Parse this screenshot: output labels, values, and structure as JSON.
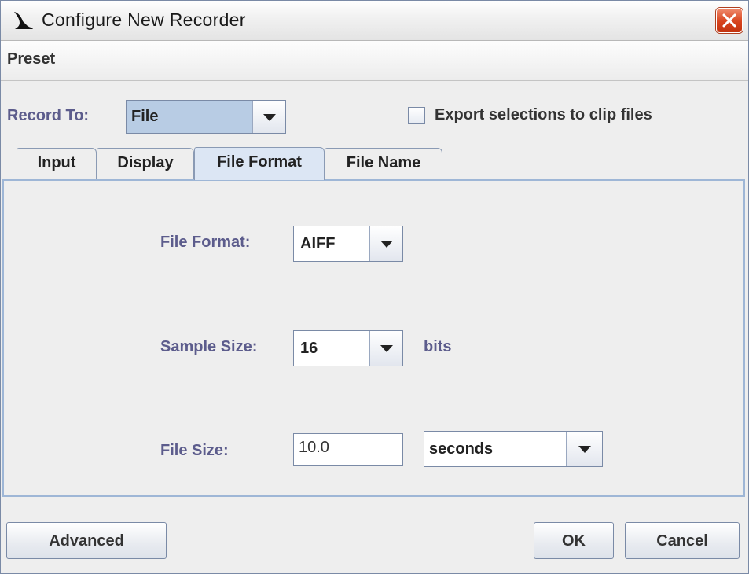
{
  "window": {
    "title": "Configure New Recorder",
    "menu": [
      "Preset"
    ]
  },
  "record_to": {
    "label": "Record To:",
    "value": "File"
  },
  "export_checkbox": {
    "label": "Export selections to clip files",
    "checked": false
  },
  "tabs": [
    {
      "label": "Input",
      "active": false
    },
    {
      "label": "Display",
      "active": false
    },
    {
      "label": "File Format",
      "active": true
    },
    {
      "label": "File Name",
      "active": false
    }
  ],
  "file_format": {
    "label": "File Format:",
    "value": "AIFF"
  },
  "sample_size": {
    "label": "Sample Size:",
    "value": "16",
    "unit": "bits"
  },
  "file_size": {
    "label": "File Size:",
    "value": "10.0",
    "unit_value": "seconds"
  },
  "buttons": {
    "advanced": "Advanced",
    "ok": "OK",
    "cancel": "Cancel"
  },
  "colors": {
    "label_blue": "#5c5c8c",
    "close_red": "#d7431d",
    "active_tab": "#dce6f4"
  }
}
